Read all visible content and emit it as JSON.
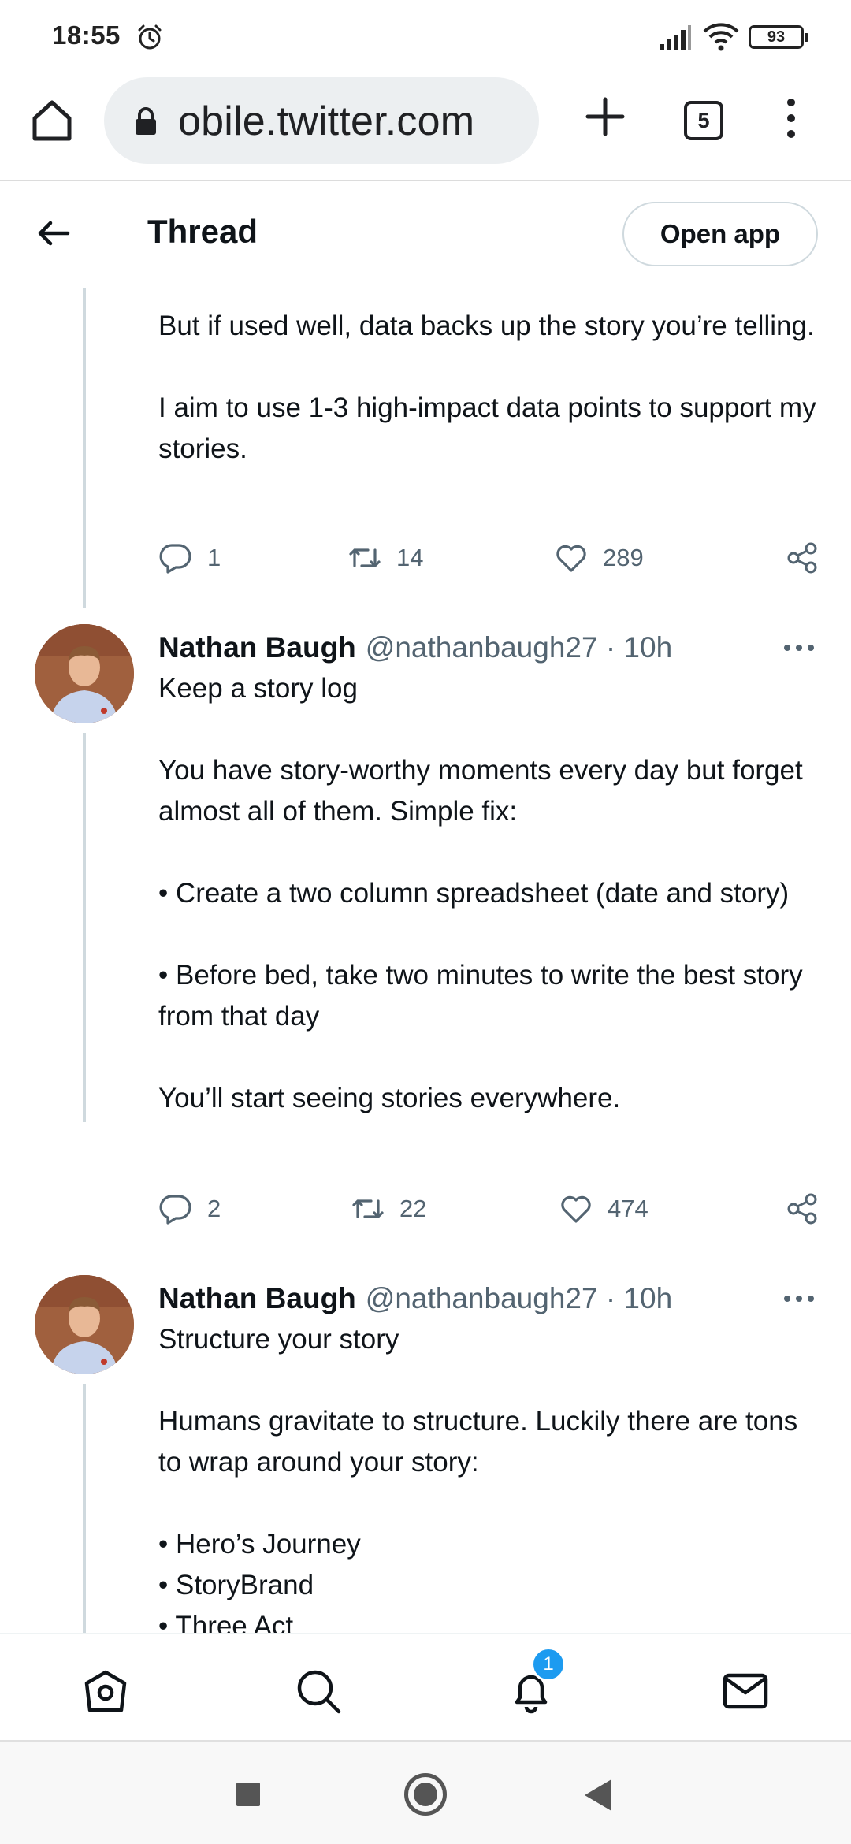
{
  "status_bar": {
    "time": "18:55",
    "battery": "93"
  },
  "browser": {
    "url": "obile.twitter.com",
    "tab_count": "5"
  },
  "header": {
    "title": "Thread",
    "open_app": "Open app"
  },
  "tweets": [
    {
      "text": "But if used well, data backs up the story you’re telling.\n\nI aim to use 1-3 high-impact data points to support my stories.",
      "replies": "1",
      "retweets": "14",
      "likes": "289"
    },
    {
      "name": "Nathan Baugh",
      "handle": "@nathanbaugh27 · 10h",
      "text": "Keep a story log\n\nYou have story-worthy moments every day but forget almost all of them. Simple fix:\n\n• Create a two column spreadsheet (date and story)\n\n• Before bed, take two minutes to write the best story from that day\n\nYou’ll start seeing stories everywhere.",
      "replies": "2",
      "retweets": "22",
      "likes": "474"
    },
    {
      "name": "Nathan Baugh",
      "handle": "@nathanbaugh27 · 10h",
      "text": "Structure your story\n\nHumans gravitate to structure. Luckily there are tons to wrap around your story:\n\n• Hero’s Journey\n• StoryBrand\n• Three Act"
    }
  ],
  "bottom_nav": {
    "notifications_badge": "1"
  },
  "icons": [
    "alarm-icon",
    "signal-icon",
    "wifi-icon",
    "battery-icon",
    "home-icon",
    "lock-icon",
    "plus-icon",
    "tabs-icon",
    "more-vert-icon",
    "back-arrow-icon",
    "reply-icon",
    "retweet-icon",
    "like-icon",
    "share-icon",
    "more-horiz-icon",
    "search-icon",
    "bell-icon",
    "mail-icon"
  ]
}
